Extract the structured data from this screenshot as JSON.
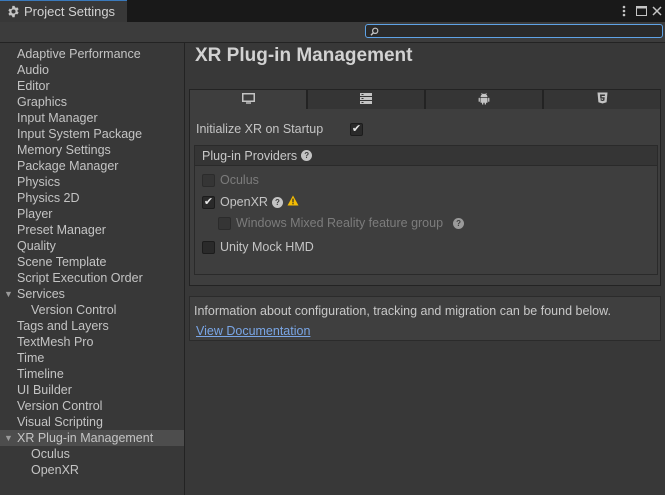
{
  "window": {
    "tab_title": "Project Settings",
    "tab_icon": "gear-icon",
    "buttons": [
      "more-vertical-icon",
      "maximize-icon",
      "close-icon"
    ]
  },
  "search": {
    "value": "",
    "placeholder": ""
  },
  "sidebar": {
    "items": [
      {
        "label": "Adaptive Performance",
        "level": 0
      },
      {
        "label": "Audio",
        "level": 0
      },
      {
        "label": "Editor",
        "level": 0
      },
      {
        "label": "Graphics",
        "level": 0
      },
      {
        "label": "Input Manager",
        "level": 0
      },
      {
        "label": "Input System Package",
        "level": 0
      },
      {
        "label": "Memory Settings",
        "level": 0
      },
      {
        "label": "Package Manager",
        "level": 0
      },
      {
        "label": "Physics",
        "level": 0
      },
      {
        "label": "Physics 2D",
        "level": 0
      },
      {
        "label": "Player",
        "level": 0
      },
      {
        "label": "Preset Manager",
        "level": 0
      },
      {
        "label": "Quality",
        "level": 0
      },
      {
        "label": "Scene Template",
        "level": 0
      },
      {
        "label": "Script Execution Order",
        "level": 0
      },
      {
        "label": "Services",
        "level": 0,
        "expanded": true
      },
      {
        "label": "Version Control",
        "level": 1
      },
      {
        "label": "Tags and Layers",
        "level": 0
      },
      {
        "label": "TextMesh Pro",
        "level": 0
      },
      {
        "label": "Time",
        "level": 0
      },
      {
        "label": "Timeline",
        "level": 0
      },
      {
        "label": "UI Builder",
        "level": 0
      },
      {
        "label": "Version Control",
        "level": 0
      },
      {
        "label": "Visual Scripting",
        "level": 0
      },
      {
        "label": "XR Plug-in Management",
        "level": 0,
        "expanded": true,
        "selected": true
      },
      {
        "label": "Oculus",
        "level": 1
      },
      {
        "label": "OpenXR",
        "level": 1
      }
    ]
  },
  "main": {
    "title": "XR Plug-in Management",
    "platform_tabs": [
      {
        "icon": "desktop-icon",
        "active": true
      },
      {
        "icon": "server-icon",
        "active": false
      },
      {
        "icon": "android-icon",
        "active": false
      },
      {
        "icon": "html5-icon",
        "active": false
      }
    ],
    "init_label": "Initialize XR on Startup",
    "init_checked": true,
    "providers_header": "Plug-in Providers",
    "providers": [
      {
        "label": "Oculus",
        "checked": false,
        "disabled": true
      },
      {
        "label": "OpenXR",
        "checked": true,
        "disabled": false
      },
      {
        "label": "Windows Mixed Reality feature group",
        "checked": false,
        "disabled": true
      },
      {
        "label": "Unity Mock HMD",
        "checked": false,
        "disabled": false
      }
    ],
    "info_text": "Information about configuration, tracking and migration can be found below.",
    "doc_link": "View Documentation"
  },
  "colors": {
    "background": "#383838",
    "selected_row": "#4d4d4d",
    "link": "#7aa6e6",
    "warning": "#f4bc02",
    "search_focus": "#5fa3e6"
  }
}
